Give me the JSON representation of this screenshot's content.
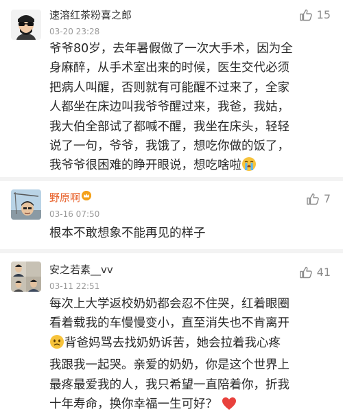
{
  "comments": [
    {
      "username": "速溶红茶粉喜之郎",
      "time": "03-20 23:28",
      "likes": "15",
      "lines": [
        "爷爷80岁，去年暑假做了一次大手术，因为全",
        "身麻醉，从手术室出来的时候，医生交代必须",
        "把病人叫醒，否则就有可能醒不过来了，全家",
        "人都坐在床边叫我爷爷醒过来，我爸，我姑，",
        "我大伯全部试了都喊不醒，我坐在床头，轻轻",
        "说了一句，爷爷，我饿了，想吃你做的饭了，",
        "我爷爷很困难的睁开眼说，想吃啥啦"
      ],
      "trailing_emoji": "crying-face",
      "username_color": "#333333"
    },
    {
      "username": "野原啊",
      "time": "03-16 07:50",
      "likes": "7",
      "lines": [
        "根本不敢想象不能再见的样子"
      ],
      "username_color": "#e8622c",
      "badge": "vip-crown"
    },
    {
      "username": "安之若素__vv",
      "time": "03-11 22:51",
      "likes": "41",
      "lines": [
        "每次上大学返校奶奶都会忍不住哭，红着眼圈",
        "看着载我的车慢慢变小，直至消失也不肯离开",
        "背爸妈骂去找奶奶诉苦，她会拉着我心疼",
        "我跟我一起哭。亲爱的奶奶，你是这个世界上",
        "最疼最爱我的人，我只希望一直陪着你，折我",
        "十年寿命，换你幸福一生可好？"
      ],
      "inline_emoji_line3": "sad-face",
      "trailing_emoji": "red-heart",
      "username_color": "#333333"
    }
  ],
  "colors": {
    "accent_orange": "#e8622c",
    "meta_gray": "#9a9a9a",
    "heart_red": "#e8413c"
  }
}
